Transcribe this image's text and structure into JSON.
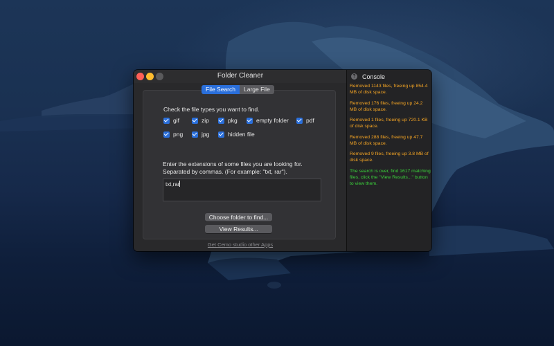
{
  "window": {
    "title": "Folder Cleaner"
  },
  "tabs": [
    {
      "label": "File Search",
      "active": true
    },
    {
      "label": "Large File",
      "active": false
    }
  ],
  "file_types": {
    "heading": "Check the file types you want to find.",
    "items": [
      {
        "label": "gif",
        "checked": true
      },
      {
        "label": "zip",
        "checked": true
      },
      {
        "label": "pkg",
        "checked": true
      },
      {
        "label": "empty folder",
        "checked": true
      },
      {
        "label": "pdf",
        "checked": true
      },
      {
        "label": "png",
        "checked": true
      },
      {
        "label": "jpg",
        "checked": true
      },
      {
        "label": "hidden file",
        "checked": true
      }
    ]
  },
  "extensions": {
    "line1": "Enter the extensions of some files you are looking for.",
    "line2": "Separated by commas. (For example: \"txt, rar\").",
    "value": "txt,rar"
  },
  "buttons": {
    "choose_folder": "Choose folder to find...",
    "view_results": "View Results..."
  },
  "footer_link": "Get Cemo studio other Apps",
  "console": {
    "title": "Console",
    "help_icon": "?",
    "messages": [
      {
        "text": "Removed 1143 files, freeing up 854.4 MB of disk space.",
        "color": "#f5a524"
      },
      {
        "text": "Removed 176 files, freeing up 24.2 MB of disk space.",
        "color": "#f5a524"
      },
      {
        "text": "Removed 1 files, freeing up 720.1 KB of disk space.",
        "color": "#f5a524"
      },
      {
        "text": "Removed 288 files, freeing up 47.7 MB of disk space.",
        "color": "#f5a524"
      },
      {
        "text": "Removed 9 files, freeing up 3.8 MB of disk space.",
        "color": "#f5a524"
      },
      {
        "text": "The search is over, find 1617 matching files, click the \"View Results...\" button to view them.",
        "color": "#3bd33b"
      }
    ]
  },
  "colors": {
    "accent": "#2a6fdb",
    "warning": "#f5a524",
    "success": "#3bd33b"
  }
}
